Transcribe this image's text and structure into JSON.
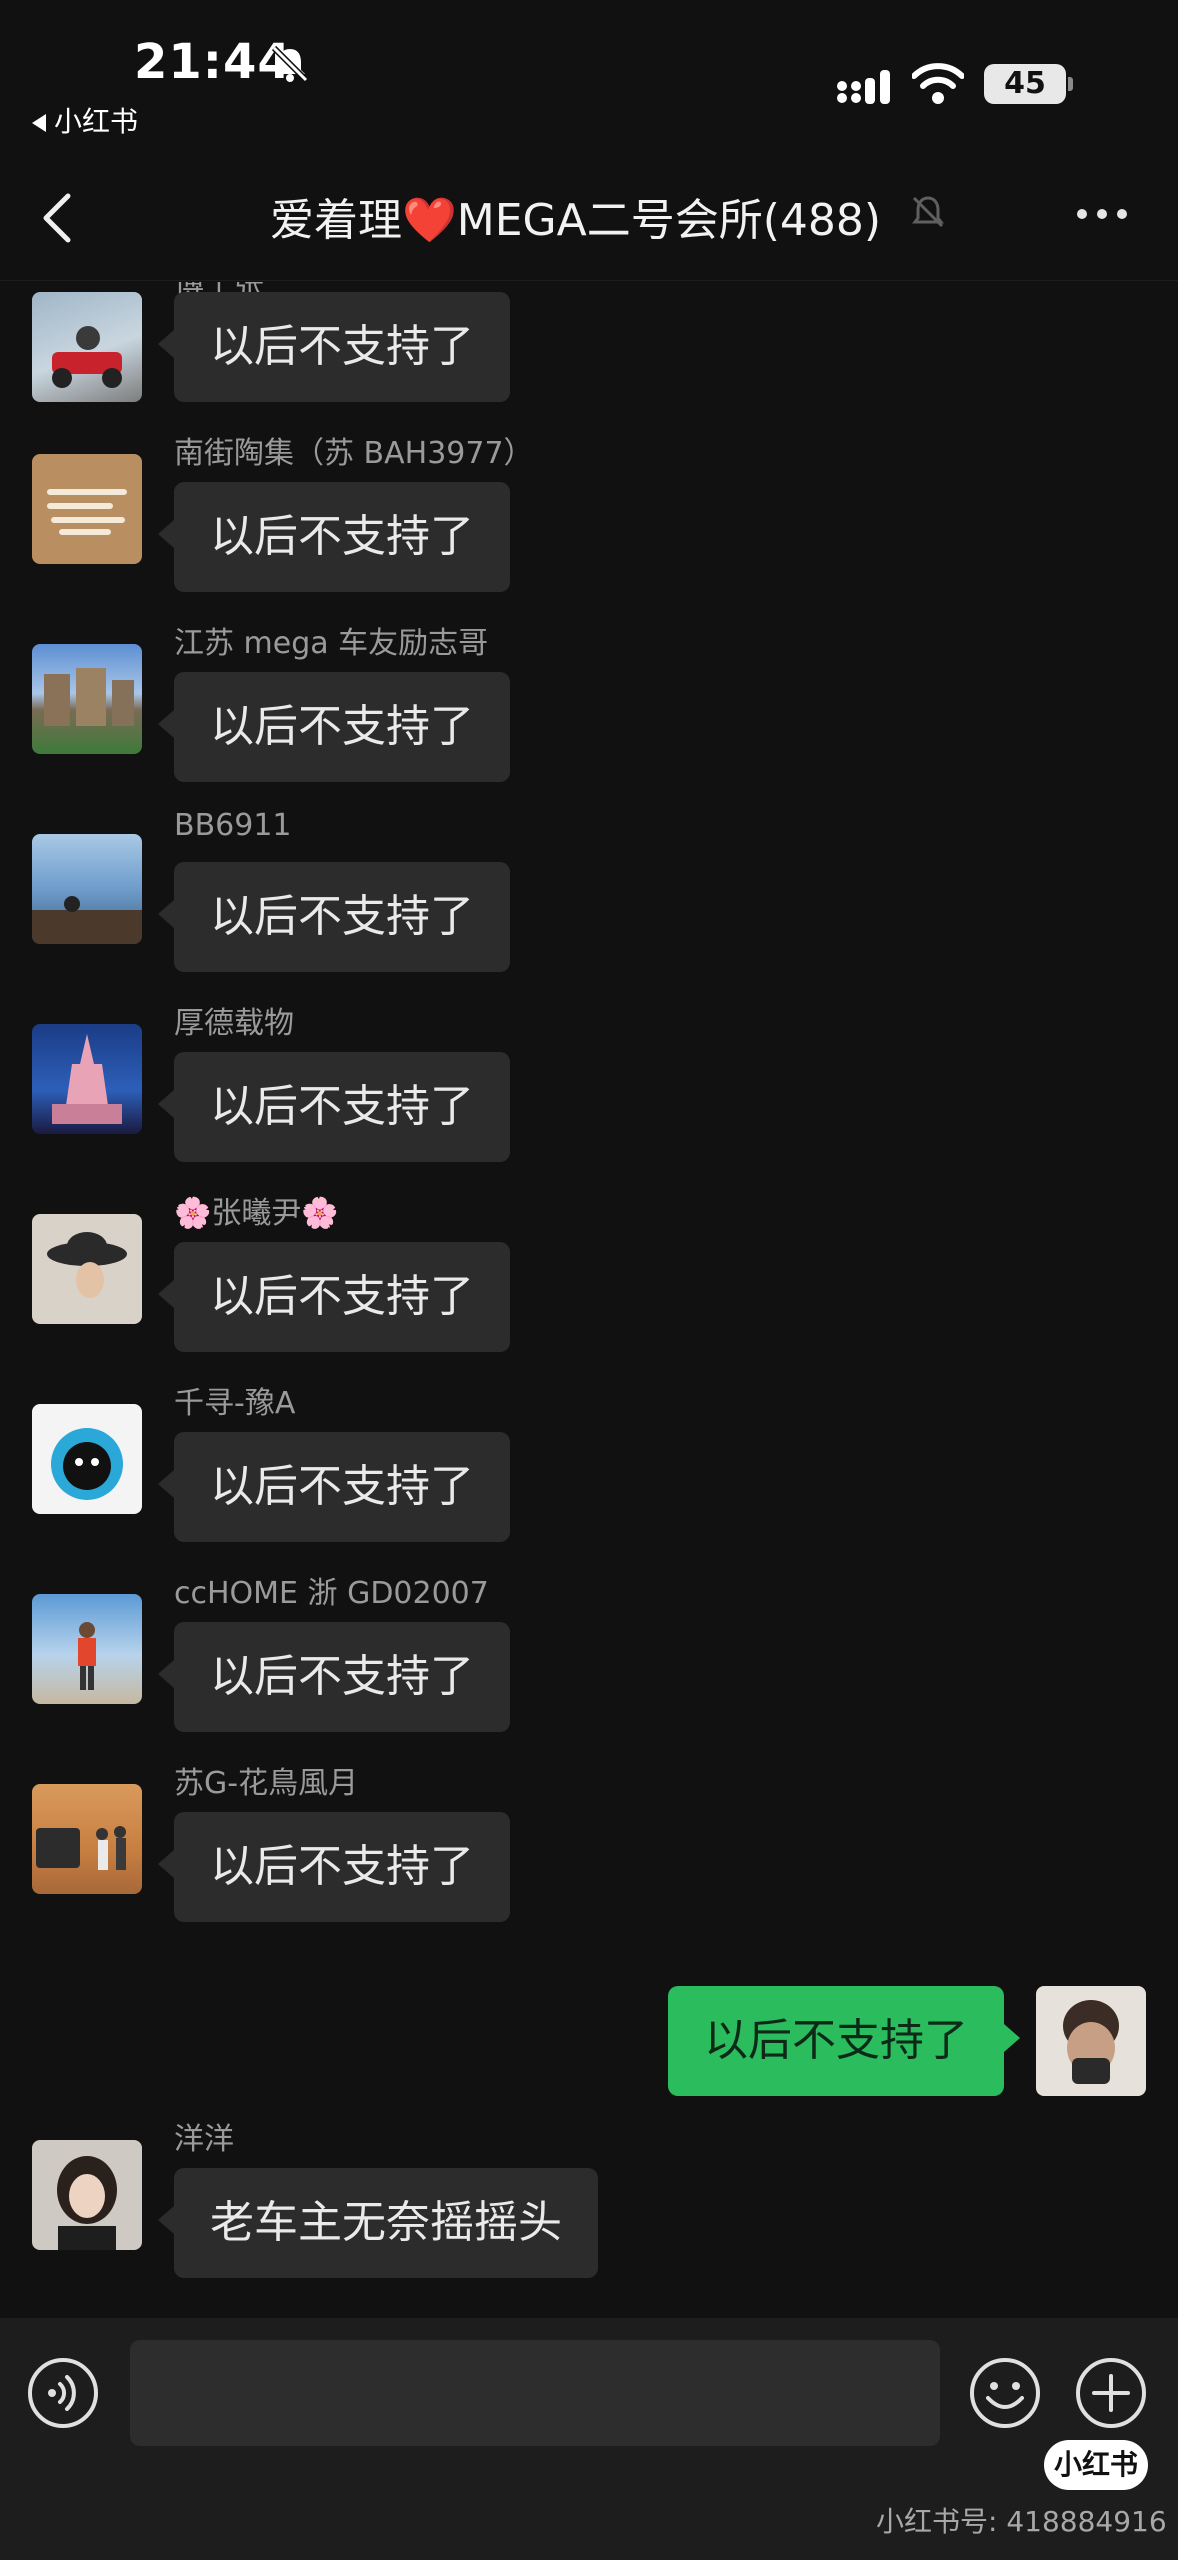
{
  "status_bar": {
    "time": "21:44",
    "back_app_label": "小红书",
    "battery": "45",
    "icons": [
      "bell-off-icon",
      "cellular-signal-icon",
      "wifi-icon",
      "battery-icon"
    ]
  },
  "nav": {
    "back_icon": "chevron-left-icon",
    "title_prefix": "爱着理",
    "title_heart": "❤️",
    "title_suffix": "MEGA二号会所(488)",
    "mute_icon": "bell-off-icon",
    "more_icon": "more-dots-icon"
  },
  "messages": [
    {
      "sender": "博士张",
      "text": "以后不支持了"
    },
    {
      "sender": "南街陶集（苏 BAH3977）",
      "text": "以后不支持了"
    },
    {
      "sender": "江苏 mega 车友励志哥",
      "text": "以后不支持了"
    },
    {
      "sender": "BB6911",
      "text": "以后不支持了"
    },
    {
      "sender": "厚德载物",
      "text": "以后不支持了"
    },
    {
      "sender": "🌸张曦尹🌸",
      "text": "以后不支持了"
    },
    {
      "sender": "千寻-豫A",
      "text": "以后不支持了"
    },
    {
      "sender": "ccHOME 浙 GD02007",
      "text": "以后不支持了"
    },
    {
      "sender": "苏G-花鳥風月",
      "text": "以后不支持了"
    },
    {
      "sender": "",
      "text": "以后不支持了",
      "self": true
    },
    {
      "sender": "洋洋",
      "text": "老车主无奈摇摇头"
    }
  ],
  "input_bar": {
    "voice_icon": "voice-icon",
    "input_value": "",
    "emoji_icon": "emoji-icon",
    "plus_icon": "plus-icon"
  },
  "watermark": {
    "badge": "小红书",
    "id_text": "小红书号: 418884916"
  },
  "colors": {
    "background": "#111111",
    "bubble_other": "#2c2c2c",
    "bubble_self": "#2bbc5e",
    "heart": "#e8313b"
  }
}
